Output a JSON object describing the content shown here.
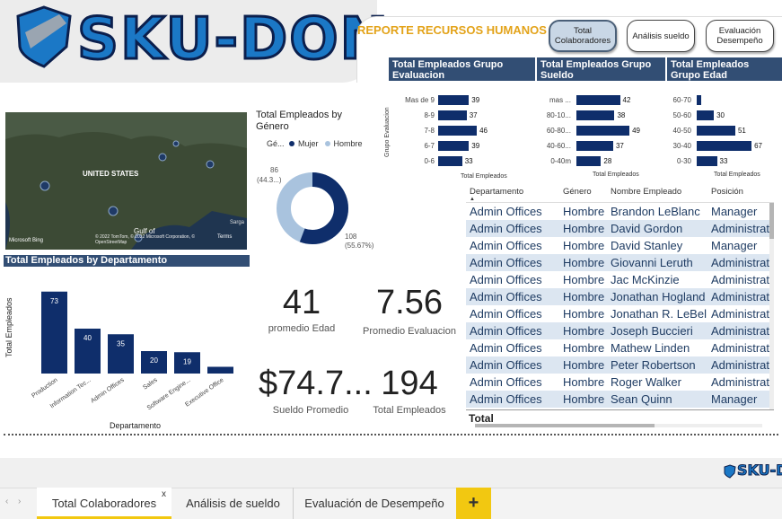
{
  "header": {
    "logo_text": "SKU-DON",
    "report_title": "REPORTE RECURSOS HUMANOS",
    "nav": [
      {
        "label": "Total Colaboradores",
        "active": true
      },
      {
        "label": "Análisis sueldo",
        "active": false
      },
      {
        "label": "Evaluación Desempeño",
        "active": false
      }
    ]
  },
  "groups": {
    "evaluacion": {
      "title": "Total Empleados Grupo Evaluacion",
      "axis_title": "Grupo Evaluacion",
      "x_title": "Total Empleados",
      "rows": [
        {
          "label": "Mas de 9",
          "value": 39
        },
        {
          "label": "8-9",
          "value": 37
        },
        {
          "label": "7-8",
          "value": 46
        },
        {
          "label": "6-7",
          "value": 39
        },
        {
          "label": "0-6",
          "value": 33
        }
      ]
    },
    "sueldo": {
      "title": "Total Empleados Grupo Sueldo",
      "x_title": "Total Empleados",
      "rows": [
        {
          "label": "mas ...",
          "value": 42
        },
        {
          "label": "80-10...",
          "value": 38
        },
        {
          "label": "60-80...",
          "value": 49
        },
        {
          "label": "40-60...",
          "value": 37
        },
        {
          "label": "0-40m",
          "value": 28
        }
      ]
    },
    "edad": {
      "title": "Total Empleados Grupo Edad",
      "x_title": "Total Empleados",
      "rows": [
        {
          "label": "60-70",
          "value": 4
        },
        {
          "label": "50-60",
          "value": 30
        },
        {
          "label": "40-50",
          "value": 51
        },
        {
          "label": "30-40",
          "value": 67
        },
        {
          "label": "0-30",
          "value": 33
        }
      ]
    }
  },
  "map": {
    "country_label": "UNITED STATES",
    "gulf_label": "Gulf of",
    "sargasso_label": "Sarga",
    "bing_label": "Microsoft Bing",
    "credits": "© 2022 TomTom, © 2022 Microsoft Corporation, © OpenStreetMap",
    "terms": "Terms"
  },
  "gender": {
    "title": "Total Empleados by Género",
    "legend_title": "Gé...",
    "legend": [
      {
        "name": "Mujer",
        "color": "#0f2e6b"
      },
      {
        "name": "Hombre",
        "color": "#a9c3de"
      }
    ],
    "hombre_label": "86",
    "hombre_pct": "(44.3...)",
    "mujer_label": "108",
    "mujer_pct": "(55.67%)"
  },
  "chart_data": {
    "type": "bar",
    "title": "Total Empleados by Departamento",
    "xlabel": "Departamento",
    "ylabel": "Total Empleados",
    "categories": [
      "Production",
      "Information Tec...",
      "Admin Offices",
      "Sales",
      "Software Engine...",
      "Executive Office"
    ],
    "values": [
      73,
      40,
      35,
      20,
      19,
      6
    ],
    "labels_shown": [
      "73",
      "40",
      "35",
      "20",
      "19",
      ""
    ],
    "ylim": [
      0,
      80
    ]
  },
  "kpis": [
    {
      "value": "41",
      "label": "promedio Edad"
    },
    {
      "value": "7.56",
      "label": "Promedio Evaluacion"
    },
    {
      "value": "$74.7...",
      "label": "Sueldo Promedio"
    },
    {
      "value": "194",
      "label": "Total Empleados"
    }
  ],
  "table": {
    "headers": [
      "Departamento",
      "Género",
      "Nombre Empleado",
      "Posición"
    ],
    "rows": [
      [
        "Admin Offices",
        "Hombre",
        "Brandon LeBlanc",
        "Manager"
      ],
      [
        "Admin Offices",
        "Hombre",
        "David Gordon",
        "Administrative"
      ],
      [
        "Admin Offices",
        "Hombre",
        "David Stanley",
        "Manager"
      ],
      [
        "Admin Offices",
        "Hombre",
        "Giovanni Leruth",
        "Administrative"
      ],
      [
        "Admin Offices",
        "Hombre",
        "Jac McKinzie",
        "Administrative"
      ],
      [
        "Admin Offices",
        "Hombre",
        "Jonathan Hogland",
        "Administrative"
      ],
      [
        "Admin Offices",
        "Hombre",
        "Jonathan R. LeBel",
        "Administrative"
      ],
      [
        "Admin Offices",
        "Hombre",
        "Joseph Buccieri",
        "Administrative"
      ],
      [
        "Admin Offices",
        "Hombre",
        "Mathew Linden",
        "Administrative"
      ],
      [
        "Admin Offices",
        "Hombre",
        "Peter Robertson",
        "Administrative"
      ],
      [
        "Admin Offices",
        "Hombre",
        "Roger Walker",
        "Administrative"
      ],
      [
        "Admin Offices",
        "Hombre",
        "Sean Quinn",
        "Manager"
      ]
    ],
    "total_label": "Total"
  },
  "footer": {
    "logo_text": "SKU-DON",
    "tabs": [
      {
        "label": "Total Colaboradores",
        "active": true
      },
      {
        "label": "Análisis de sueldo",
        "active": false
      },
      {
        "label": "Evaluación de Desempeño",
        "active": false
      }
    ],
    "add_label": "+",
    "close_label": "x"
  },
  "colors": {
    "primary": "#0f2e6b",
    "header": "#324e74",
    "accent": "#e3a31a",
    "light": "#a9c3de"
  }
}
